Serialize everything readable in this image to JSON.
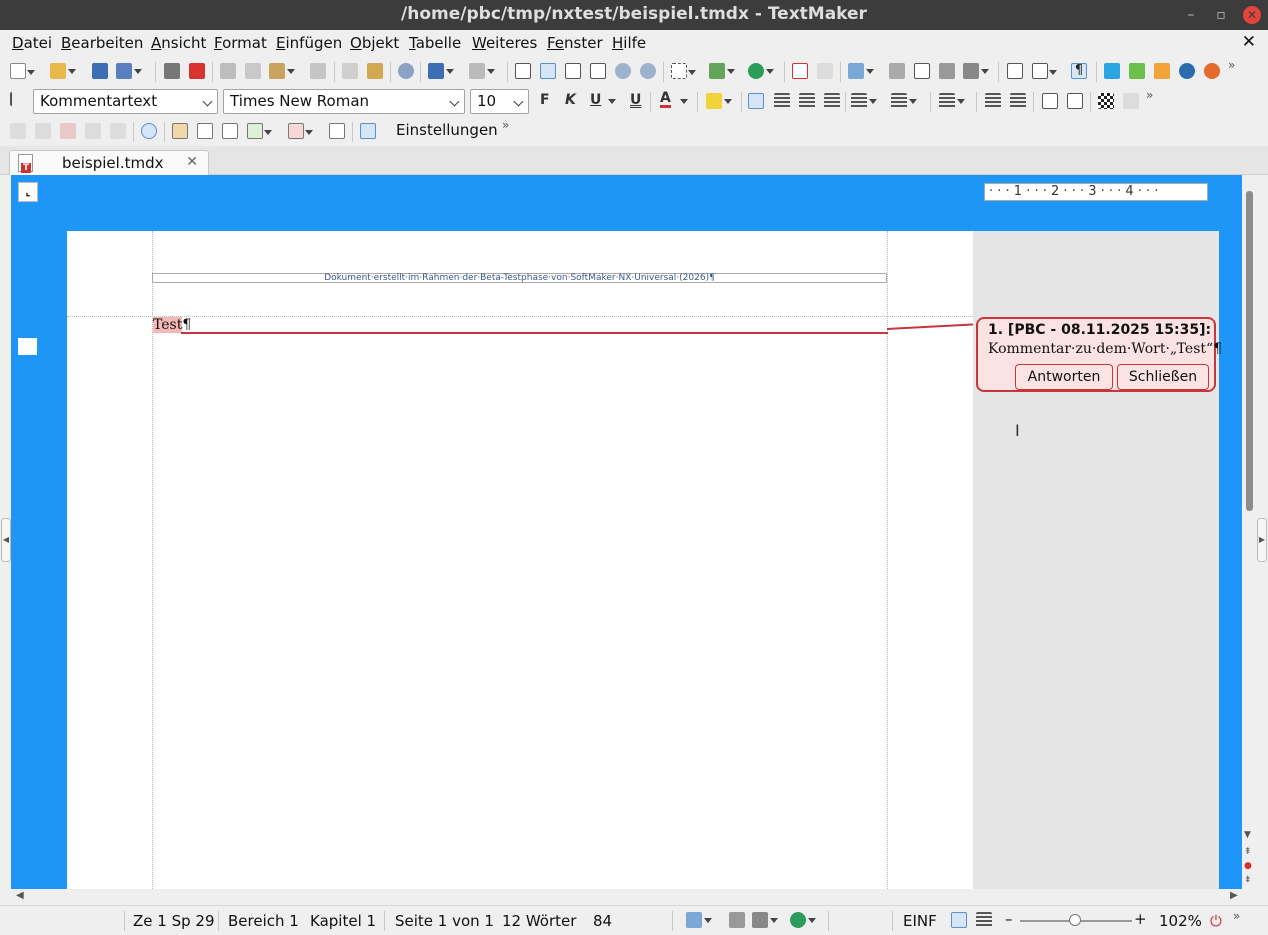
{
  "window": {
    "title": "/home/pbc/tmp/nxtest/beispiel.tmdx - TextMaker"
  },
  "menu": {
    "items": [
      {
        "u": "D",
        "rest": "atei"
      },
      {
        "u": "B",
        "rest": "earbeiten"
      },
      {
        "u": "A",
        "rest": "nsicht"
      },
      {
        "u": "F",
        "rest": "ormat"
      },
      {
        "u": "E",
        "rest": "infügen"
      },
      {
        "u": "O",
        "rest": "bjekt"
      },
      {
        "u": "T",
        "rest": "abelle"
      },
      {
        "u": "W",
        "rest": "eiteres"
      },
      {
        "u": "Fe",
        "rest": "nster"
      },
      {
        "u": "H",
        "rest": "ilfe"
      }
    ],
    "close": "✕"
  },
  "format_bar": {
    "style": "Kommentartext",
    "font": "Times New Roman",
    "size": "10",
    "bold": "F",
    "italic": "K",
    "underline": "U",
    "double_underline": "U",
    "font_color": "A"
  },
  "comment_toolbar": {
    "settings_label": "Einstellungen"
  },
  "tabs": [
    {
      "label": "beispiel.tmdx",
      "close": "✕"
    }
  ],
  "ruler": {
    "text": "· · · 1 · · · 2 · · · 3 · · · 4 · · ·"
  },
  "document": {
    "header_text": "Dokument·erstellt·im·Rahmen·der·Beta-Testphase·von·SoftMaker·NX·Universal·(2026)¶",
    "body_text": "Test",
    "pilcrow": "¶"
  },
  "comment": {
    "header": "1. [PBC - 08.11.2025 15:35]:",
    "body": "Kommentar·zu·dem·Wort·„Test“¶",
    "reply_label": "Antworten",
    "close_label": "Schließen"
  },
  "status": {
    "position": "Ze 1 Sp 29",
    "section": "Bereich 1",
    "chapter": "Kapitel 1",
    "page": "Seite 1 von 1",
    "words": "12 Wörter",
    "count": "84",
    "mode": "EINF",
    "zoom": "102%",
    "zoom_level_percent": 102
  },
  "colors": {
    "workspace": "#1e96f7",
    "comment_border": "#c8363c",
    "comment_bg": "#fbe3e3"
  }
}
